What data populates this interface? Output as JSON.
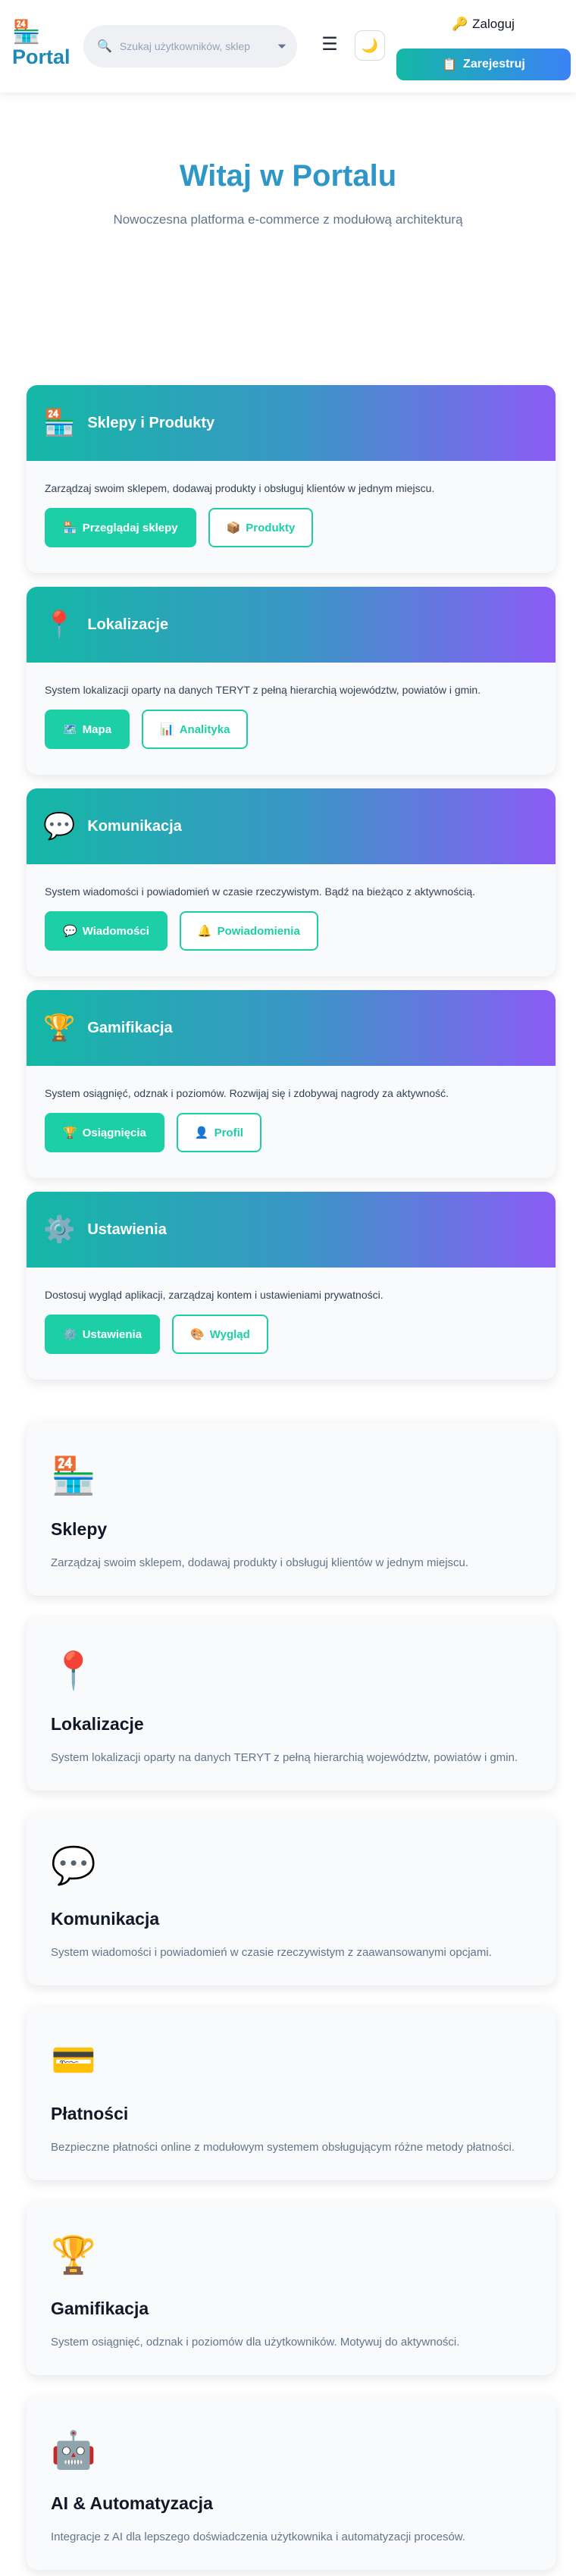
{
  "header": {
    "logo_icon": "🏪",
    "logo_text": "Portal",
    "search_placeholder": "Szukaj użytkowników, sklep",
    "search_icon": "🔍",
    "filter_icon": "⏷",
    "menu_icon": "☰",
    "theme_icon": "🌙",
    "login_icon": "🔑",
    "login_label": "Zaloguj",
    "register_icon": "📋",
    "register_label": "Zarejestruj"
  },
  "hero": {
    "title": "Witaj w Portalu",
    "subtitle": "Nowoczesna platforma e-commerce z modułową architekturą"
  },
  "modules": [
    {
      "icon": "🏪",
      "title": "Sklepy i Produkty",
      "description": "Zarządzaj swoim sklepem, dodawaj produkty i obsługuj klientów w jednym miejscu.",
      "primary": {
        "icon": "🏪",
        "label": "Przeglądaj sklepy"
      },
      "secondary": {
        "icon": "📦",
        "label": "Produkty"
      }
    },
    {
      "icon": "📍",
      "title": "Lokalizacje",
      "description": "System lokalizacji oparty na danych TERYT z pełną hierarchią województw, powiatów i gmin.",
      "primary": {
        "icon": "🗺️",
        "label": "Mapa"
      },
      "secondary": {
        "icon": "📊",
        "label": "Analityka"
      }
    },
    {
      "icon": "💬",
      "title": "Komunikacja",
      "description": "System wiadomości i powiadomień w czasie rzeczywistym. Bądź na bieżąco z aktywnością.",
      "primary": {
        "icon": "💬",
        "label": "Wiadomości"
      },
      "secondary": {
        "icon": "🔔",
        "label": "Powiadomienia"
      }
    },
    {
      "icon": "🏆",
      "title": "Gamifikacja",
      "description": "System osiągnięć, odznak i poziomów. Rozwijaj się i zdobywaj nagrody za aktywność.",
      "primary": {
        "icon": "🏆",
        "label": "Osiągnięcia"
      },
      "secondary": {
        "icon": "👤",
        "label": "Profil"
      }
    },
    {
      "icon": "⚙️",
      "title": "Ustawienia",
      "description": "Dostosuj wygląd aplikacji, zarządzaj kontem i ustawieniami prywatności.",
      "primary": {
        "icon": "⚙️",
        "label": "Ustawienia"
      },
      "secondary": {
        "icon": "🎨",
        "label": "Wygląd"
      }
    }
  ],
  "features": [
    {
      "icon": "🏪",
      "title": "Sklepy",
      "description": "Zarządzaj swoim sklepem, dodawaj produkty i obsługuj klientów w jednym miejscu."
    },
    {
      "icon": "📍",
      "title": "Lokalizacje",
      "description": "System lokalizacji oparty na danych TERYT z pełną hierarchią województw, powiatów i gmin."
    },
    {
      "icon": "💬",
      "title": "Komunikacja",
      "description": "System wiadomości i powiadomień w czasie rzeczywistym z zaawansowanymi opcjami."
    },
    {
      "icon": "💳",
      "title": "Płatności",
      "description": "Bezpieczne płatności online z modułowym systemem obsługującym różne metody płatności."
    },
    {
      "icon": "🏆",
      "title": "Gamifikacja",
      "description": "System osiągnięć, odznak i poziomów dla użytkowników. Motywuj do aktywności."
    },
    {
      "icon": "🤖",
      "title": "AI & Automatyzacja",
      "description": "Integracje z AI dla lepszego doświadczenia użytkownika i automatyzacji procesów."
    }
  ],
  "colors": {
    "brand": "#1e88b6",
    "accent": "#1ccfa6",
    "gradient_start": "#14b8a6",
    "gradient_end": "#8b5cf6"
  }
}
